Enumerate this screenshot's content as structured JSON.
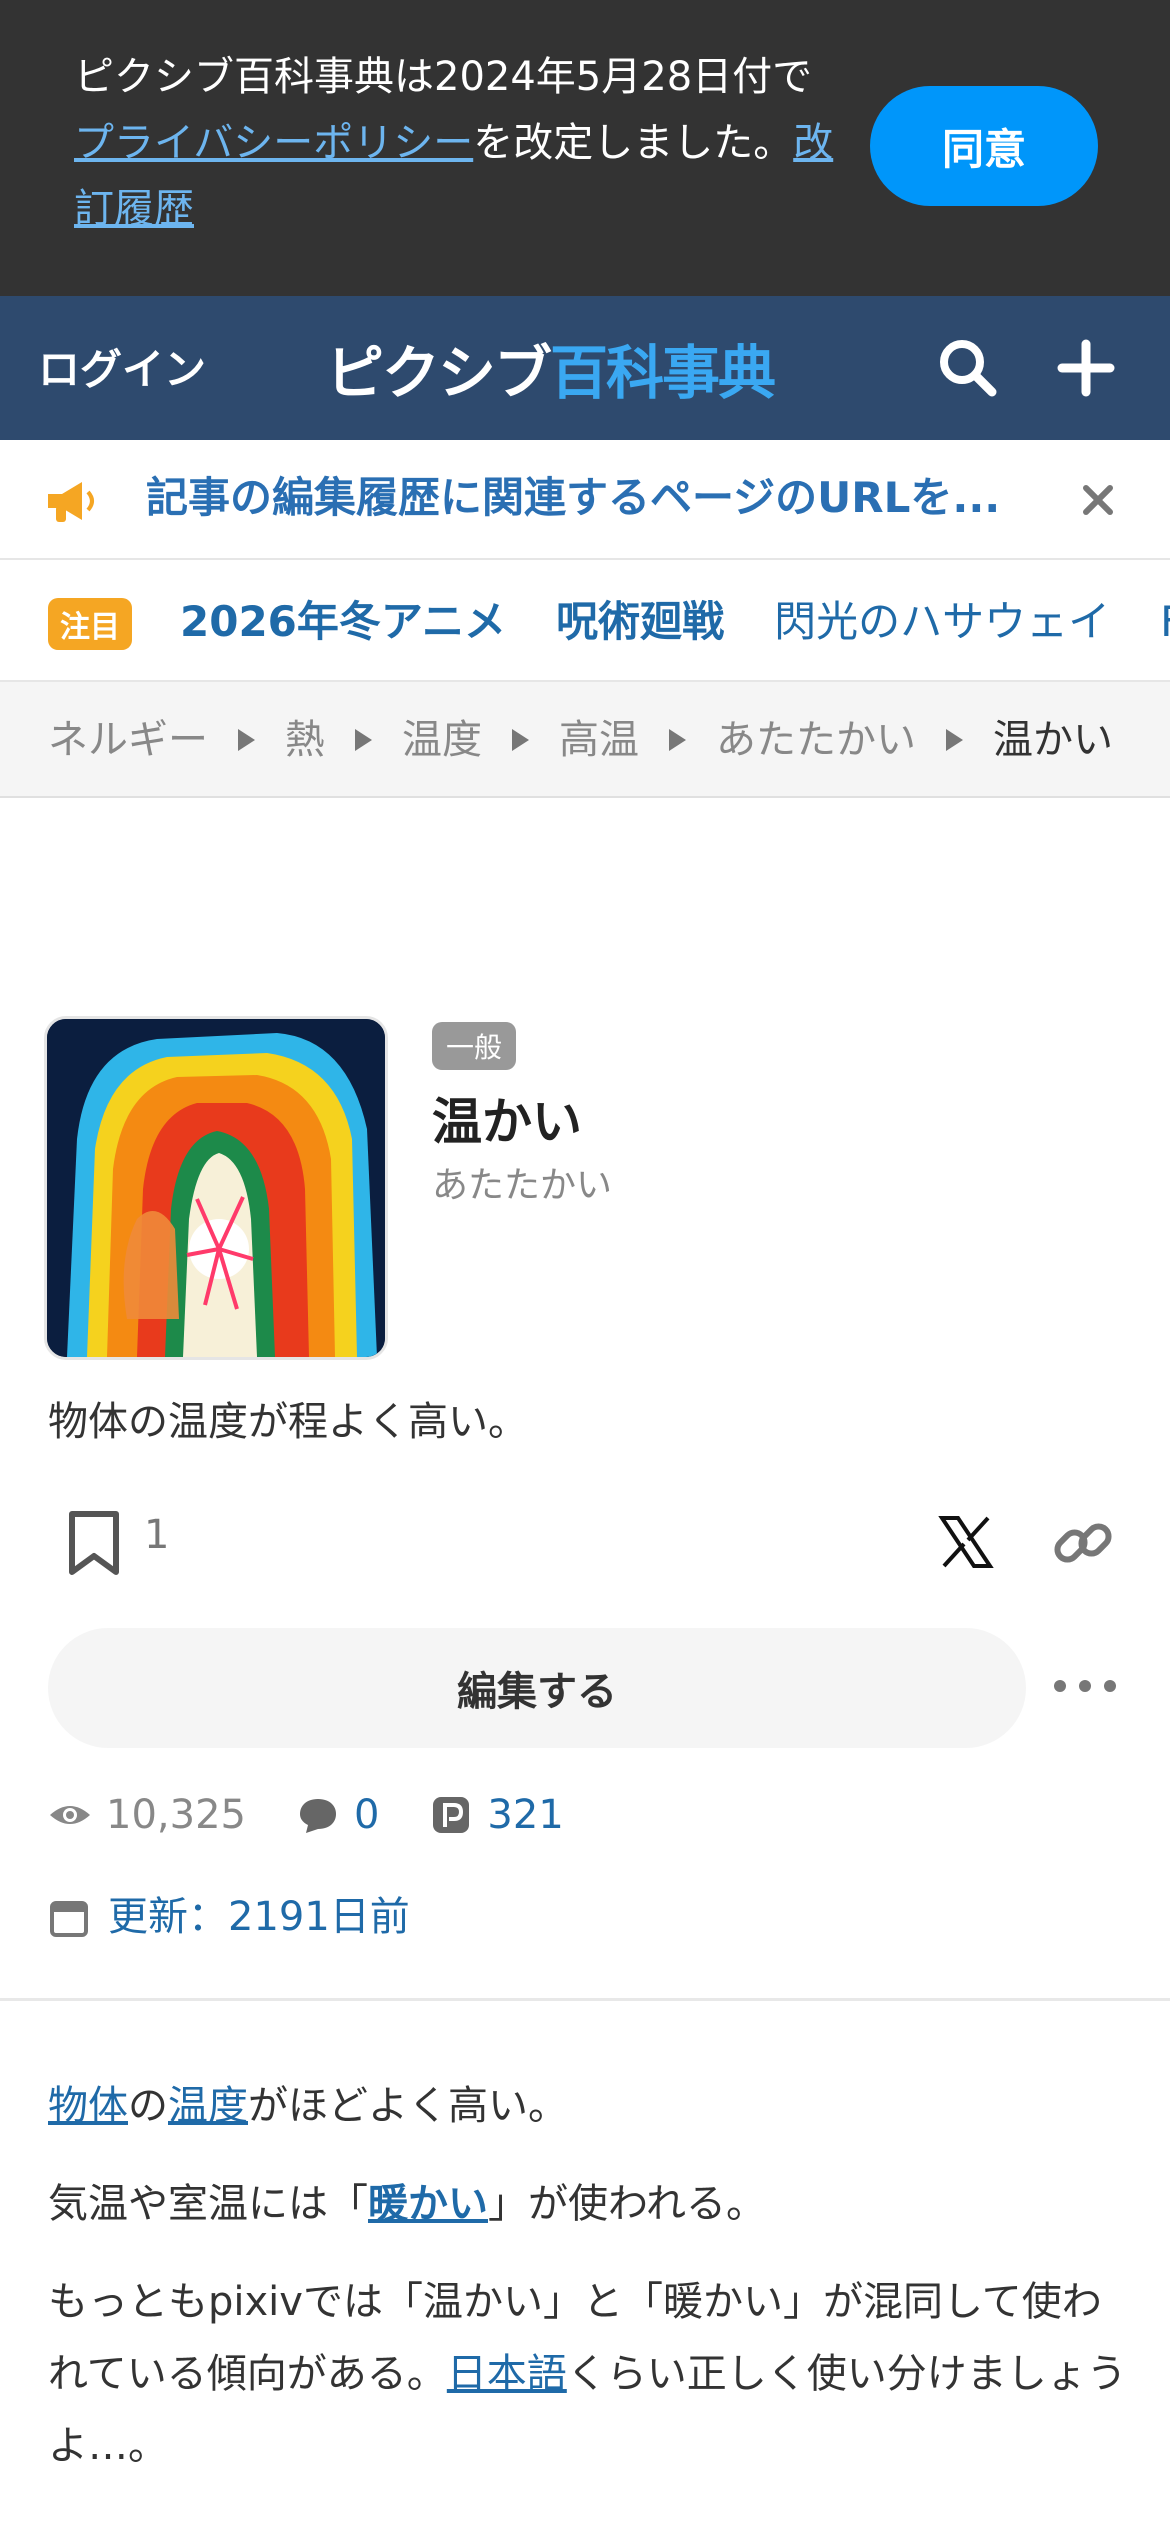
{
  "consent": {
    "text_1": "ピクシブ百科事典は2024年5月28日付で",
    "privacy_link": "プライバシーポリシー",
    "text_2": "を改定しました。",
    "history_link": "改訂履歴",
    "agree_label": "同意",
    "colors": {
      "background": "#333333",
      "button": "#0096fa"
    }
  },
  "header": {
    "login_label": "ログイン",
    "logo_part_1": "ピクシブ",
    "logo_part_2": "百科事典",
    "search_icon": "search-icon",
    "add_icon": "plus-icon",
    "colors": {
      "background": "#2e4a6e"
    }
  },
  "notice": {
    "icon": "megaphone-icon",
    "text": "記事の編集履歴に関連するページのURLを...",
    "close_icon": "close-icon"
  },
  "trending": {
    "badge": "注目",
    "items": [
      "2026年冬アニメ",
      "呪術廻戦",
      "閃光のハサウェイ",
      "F"
    ]
  },
  "breadcrumb": {
    "items": [
      "ネルギー",
      "熱",
      "温度",
      "高温",
      "あたたかい"
    ],
    "current": "温かい"
  },
  "article": {
    "category_badge": "一般",
    "title": "温かい",
    "reading": "あたたかい",
    "summary": "物体の温度が程よく高い。",
    "bookmark_count": "1",
    "edit_label": "編集する",
    "stats": {
      "views": "10,325",
      "comments": "0",
      "pixiv": "321"
    },
    "updated_label": "更新：2191日前"
  },
  "body": {
    "p1_link_1": "物体",
    "p1_text_1": "の",
    "p1_link_2": "温度",
    "p1_text_2": "がほどよく高い。",
    "p2_text_1": "気温や室温には「",
    "p2_link": "暖かい",
    "p2_text_2": "」が使われる。",
    "p3_text_1": "もっともpixivでは「温かい」と「暖かい」が混同して使われている傾向がある。",
    "p3_link": "日本語",
    "p3_text_2": "くらい正しく使い分けましょうよ…。"
  }
}
